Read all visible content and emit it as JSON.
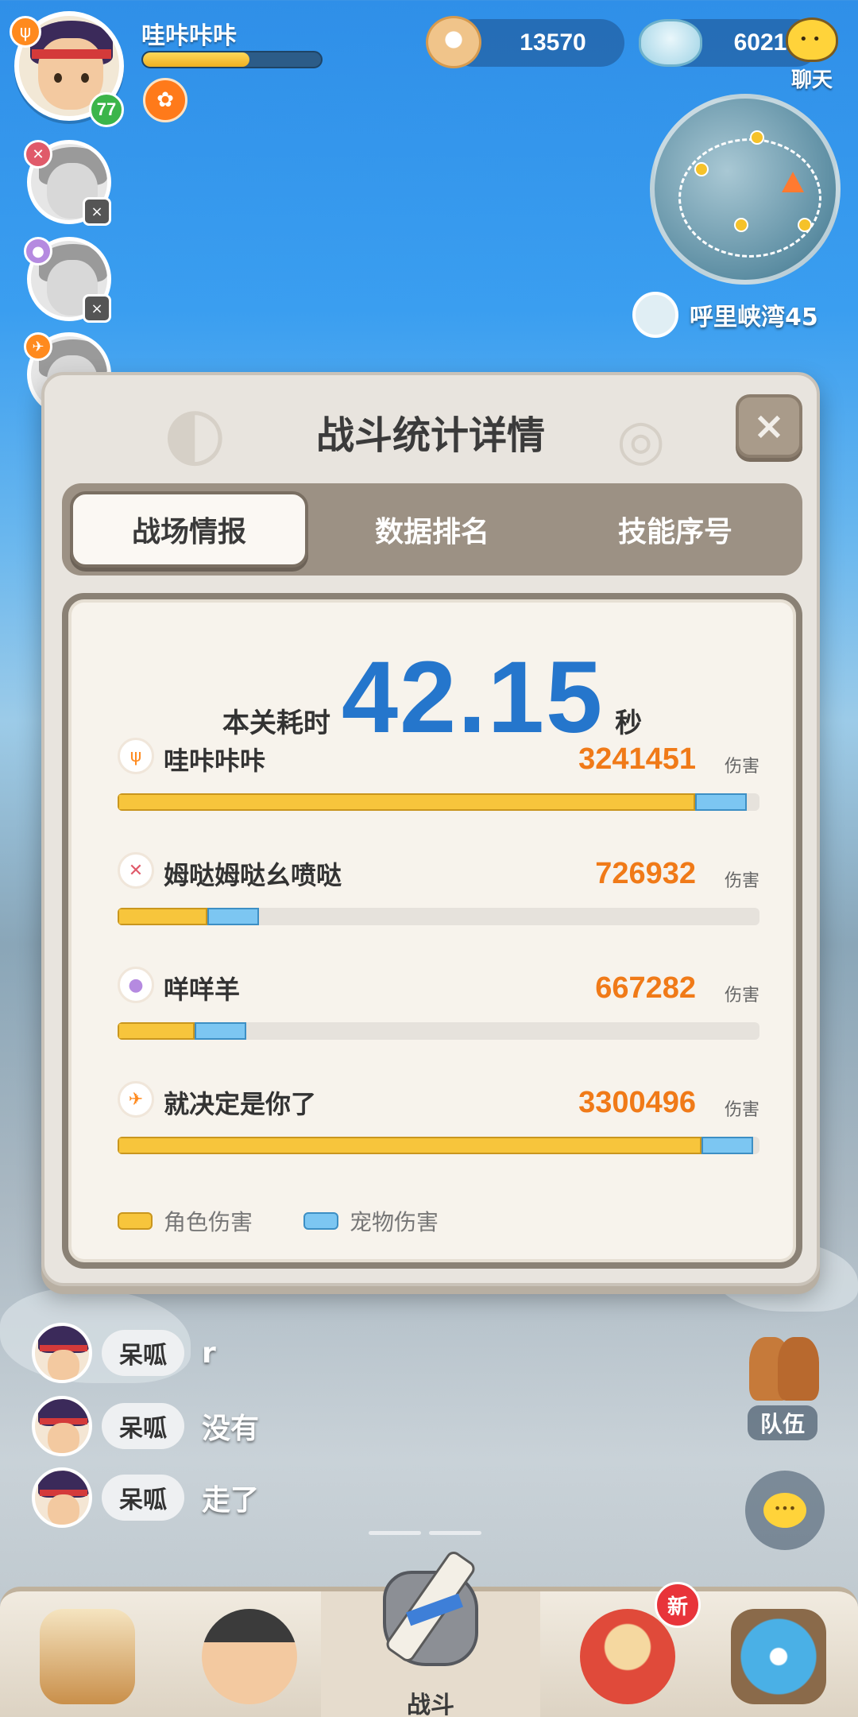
{
  "hud": {
    "player_name": "哇咔咔咔",
    "level": "77",
    "hp_fraction": 0.6,
    "currency_shell": "13570",
    "currency_gem": "6021",
    "chat_label": "聊天",
    "location": "呼里峡湾45",
    "buff_icon": "paw-icon"
  },
  "modal": {
    "title": "战斗统计详情",
    "close_label": "×",
    "tabs": [
      {
        "label": "战场情报",
        "active": true
      },
      {
        "label": "数据排名",
        "active": false
      },
      {
        "label": "技能序号",
        "active": false
      }
    ],
    "time_label": "本关耗时",
    "time_value": "42.15",
    "time_unit": "秒",
    "damage_unit": "伤害",
    "stats": [
      {
        "name": "哇咔咔咔",
        "value": "3241451",
        "icon": "fire-element-icon",
        "role_fraction": 0.9,
        "pet_fraction": 0.08
      },
      {
        "name": "姆哒姆哒幺喷哒",
        "value": "726932",
        "icon": "demon-element-icon",
        "role_fraction": 0.14,
        "pet_fraction": 0.08
      },
      {
        "name": "咩咩羊",
        "value": "667282",
        "icon": "purple-orb-icon",
        "role_fraction": 0.12,
        "pet_fraction": 0.08
      },
      {
        "name": "就决定是你了",
        "value": "3300496",
        "icon": "bird-element-icon",
        "role_fraction": 0.91,
        "pet_fraction": 0.08
      }
    ],
    "legend": {
      "role": "角色伤害",
      "pet": "宠物伤害"
    }
  },
  "chat": {
    "messages": [
      {
        "name": "呆呱",
        "text": "r"
      },
      {
        "name": "呆呱",
        "text": "没有"
      },
      {
        "name": "呆呱",
        "text": "走了"
      }
    ]
  },
  "side": {
    "team_label": "队伍"
  },
  "nav": {
    "items": [
      "beast-tab",
      "character-tab",
      "battle-tab",
      "pet-tab",
      "portal-tab"
    ],
    "battle_label": "战斗",
    "new_badge": "新"
  },
  "colors": {
    "role_damage": "#f7c53c",
    "pet_damage": "#7cc6f2",
    "damage_value": "#f07a18",
    "time_value": "#2576cc"
  }
}
